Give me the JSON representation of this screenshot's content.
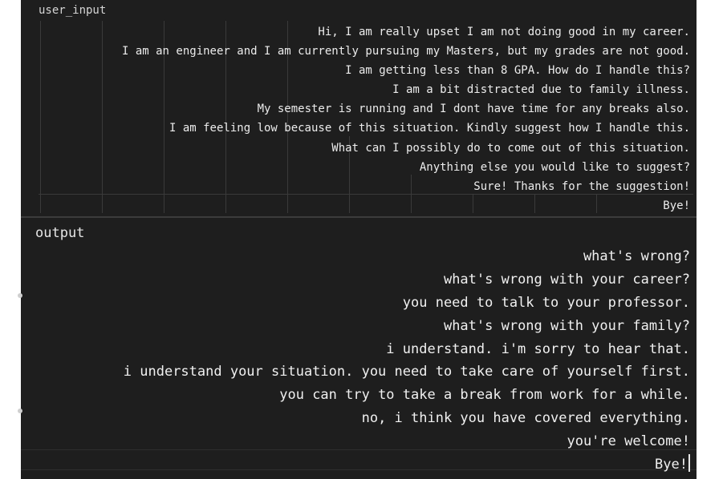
{
  "user_input": {
    "label": "user_input",
    "lines": [
      "Hi, I am really upset I am not doing good in my career.",
      "I am an engineer and I am currently pursuing my Masters, but my grades are not good.",
      "I am getting less than 8 GPA. How do I handle this?",
      "I am a bit distracted due to family illness.",
      "My semester is running and I dont have time for any breaks also.",
      "I am feeling low because of this situation. Kindly suggest how I handle this.",
      "What can I possibly do to come out of this situation.",
      "Anything else you would like to suggest?",
      "Sure! Thanks for the suggestion!",
      "Bye!"
    ]
  },
  "output": {
    "label": "output",
    "lines": [
      "what's wrong?",
      "what's wrong with your career?",
      "you need to talk to your professor.",
      "what's wrong with your family?",
      "i understand. i'm sorry to hear that.",
      "i understand your situation. you need to take care of yourself first.",
      "you can try to take a break from work for a while.",
      "no, i think you have covered everything.",
      "you're welcome!",
      "Bye!"
    ]
  }
}
